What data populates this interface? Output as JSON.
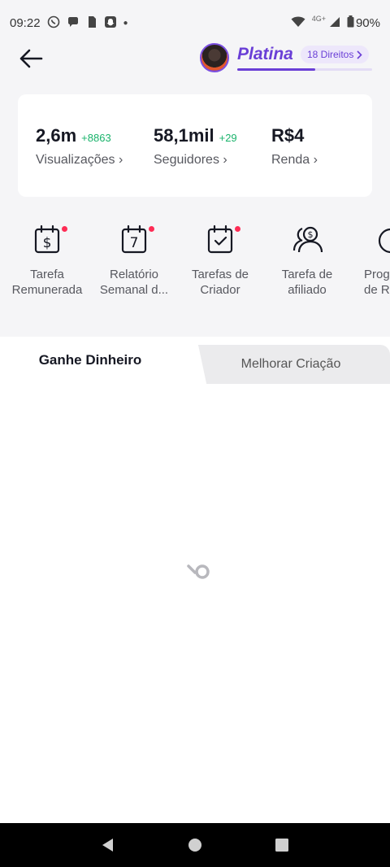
{
  "status_bar": {
    "time": "09:22",
    "network": "4G+",
    "battery": "90%",
    "notification_icons": [
      "whatsapp-icon",
      "chat-icon",
      "sim-icon",
      "snapchat-icon"
    ]
  },
  "header": {
    "tier_name": "Platina",
    "rights_label": "18 Direitos",
    "tier_progress": 0.58
  },
  "stats": [
    {
      "value": "2,6m",
      "delta": "+8863",
      "label": "Visualizações"
    },
    {
      "value": "58,1mil",
      "delta": "+29",
      "label": "Seguidores"
    },
    {
      "value": "R$4",
      "delta": "",
      "label": "Renda"
    }
  ],
  "shortcuts": [
    {
      "label": "Tarefa\nRemunerada",
      "icon": "calendar-dollar-icon",
      "badge": true
    },
    {
      "label": "Relatório\nSemanal d...",
      "icon": "calendar-7-icon",
      "badge": true
    },
    {
      "label": "Tarefas de\nCriador",
      "icon": "calendar-check-icon",
      "badge": true
    },
    {
      "label": "Tarefa de\nafiliado",
      "icon": "affiliate-users-icon",
      "badge": false
    },
    {
      "label": "Prog\nde Re",
      "icon": "program-icon",
      "badge": false
    }
  ],
  "tabs": {
    "active": "Ganhe Dinheiro",
    "inactive": "Melhorar Criação"
  },
  "colors": {
    "accent": "#6a3fd6",
    "positive": "#19b36b",
    "badge": "#fe2c55"
  }
}
